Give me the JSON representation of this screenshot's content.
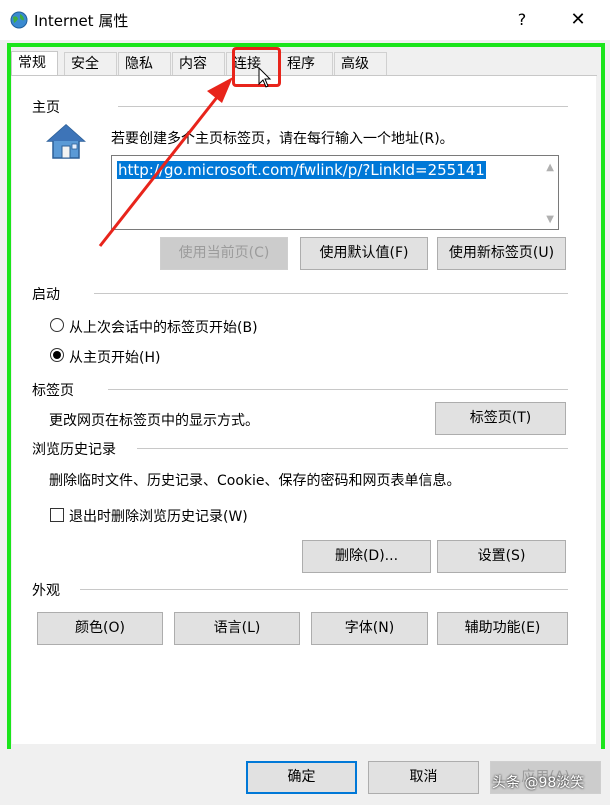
{
  "window": {
    "title": "Internet 属性",
    "help_glyph": "?",
    "close_glyph": "✕"
  },
  "tabs": [
    {
      "label": "常规",
      "active": true
    },
    {
      "label": "安全"
    },
    {
      "label": "隐私"
    },
    {
      "label": "内容"
    },
    {
      "label": "连接",
      "highlighted": true
    },
    {
      "label": "程序"
    },
    {
      "label": "高级"
    }
  ],
  "homepage": {
    "title": "主页",
    "instruction": "若要创建多个主页标签页，请在每行输入一个地址(R)。",
    "url": "http://go.microsoft.com/fwlink/p/?LinkId=255141",
    "buttons": {
      "use_current": "使用当前页(C)",
      "use_default": "使用默认值(F)",
      "use_new_tab": "使用新标签页(U)"
    }
  },
  "startup": {
    "title": "启动",
    "option_last_session": "从上次会话中的标签页开始(B)",
    "option_homepage": "从主页开始(H)"
  },
  "tabs_section": {
    "title": "标签页",
    "description": "更改网页在标签页中的显示方式。",
    "button": "标签页(T)"
  },
  "history": {
    "title": "浏览历史记录",
    "description": "删除临时文件、历史记录、Cookie、保存的密码和网页表单信息。",
    "delete_on_exit": "退出时删除浏览历史记录(W)",
    "delete_button": "删除(D)...",
    "settings_button": "设置(S)"
  },
  "appearance": {
    "title": "外观",
    "colors": "颜色(O)",
    "languages": "语言(L)",
    "fonts": "字体(N)",
    "accessibility": "辅助功能(E)"
  },
  "footer": {
    "ok": "确定",
    "cancel": "取消",
    "apply": "应用(A)"
  },
  "watermark": "头条 @98淡笑",
  "colors": {
    "annotation_green": "#1be51b",
    "annotation_red": "#e8241b",
    "selection_blue": "#0078d7"
  }
}
